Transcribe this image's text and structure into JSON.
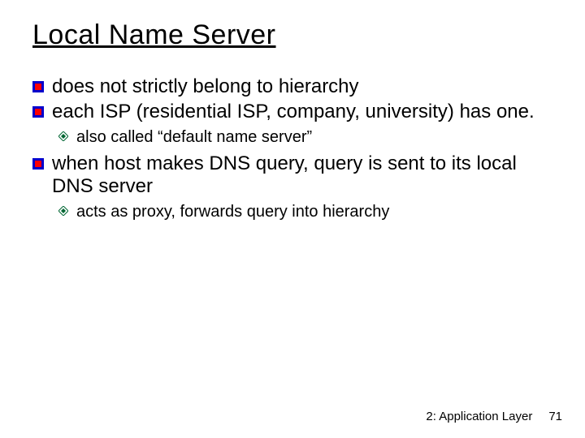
{
  "title": "Local Name Server",
  "l1": {
    "b0": "does not strictly belong to hierarchy",
    "b1": "each ISP (residential ISP, company, university) has one.",
    "b2": "when host makes DNS query, query is sent to its local DNS server"
  },
  "l2": {
    "s0": "also called “default name server”",
    "s1": "acts as proxy, forwards query into hierarchy"
  },
  "footer": {
    "section": "2: Application Layer",
    "page": "71"
  }
}
